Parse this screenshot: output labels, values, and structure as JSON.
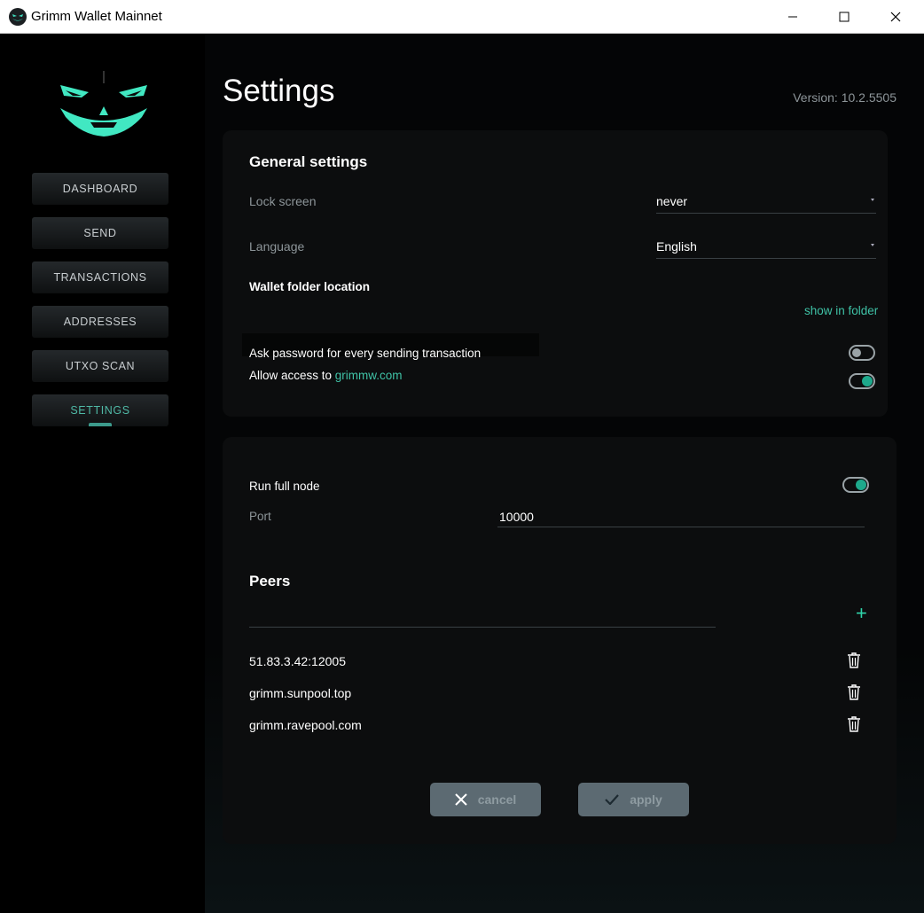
{
  "window": {
    "title": "Grimm Wallet Mainnet"
  },
  "sidebar": {
    "items": [
      {
        "label": "DASHBOARD"
      },
      {
        "label": "SEND"
      },
      {
        "label": "TRANSACTIONS"
      },
      {
        "label": "ADDRESSES"
      },
      {
        "label": "UTXO SCAN"
      },
      {
        "label": "SETTINGS",
        "active": true
      }
    ]
  },
  "header": {
    "title": "Settings",
    "version": "Version: 10.2.5505"
  },
  "general": {
    "title": "General settings",
    "lock_screen_label": "Lock screen",
    "lock_screen_value": "never",
    "language_label": "Language",
    "language_value": "English",
    "wallet_folder_label": "Wallet folder location",
    "show_in_folder": "show in folder",
    "ask_password_label": "Ask password for every sending transaction",
    "ask_password_on": false,
    "allow_access_prefix": "Allow access to ",
    "allow_access_link": "grimmw.com",
    "allow_access_on": true
  },
  "node": {
    "run_full_node_label": "Run full node",
    "run_full_node_on": true,
    "port_label": "Port",
    "port_value": "10000",
    "peers_title": "Peers",
    "peers": [
      "51.83.3.42:12005",
      "grimm.sunpool.top",
      "grimm.ravepool.com"
    ],
    "cancel_label": "cancel",
    "apply_label": "apply"
  },
  "colors": {
    "accent": "#3fc2a6",
    "toggle_on": "#1ea98c",
    "button": "#5c6a72"
  }
}
